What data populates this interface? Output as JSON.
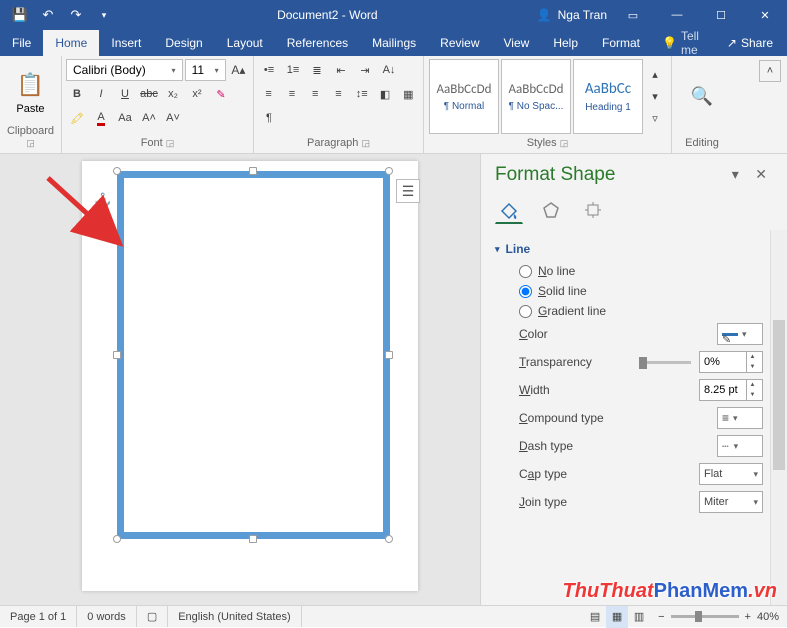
{
  "titlebar": {
    "title": "Document2 - Word",
    "user": "Nga Tran"
  },
  "tabs": {
    "file": "File",
    "home": "Home",
    "insert": "Insert",
    "design": "Design",
    "layout": "Layout",
    "references": "References",
    "mailings": "Mailings",
    "review": "Review",
    "view": "View",
    "help": "Help",
    "format": "Format",
    "tellme": "Tell me",
    "share": "Share"
  },
  "ribbon": {
    "clipboard": {
      "paste": "Paste",
      "label": "Clipboard"
    },
    "font": {
      "name": "Calibri (Body)",
      "size": "11",
      "label": "Font"
    },
    "paragraph": {
      "label": "Paragraph"
    },
    "styles": {
      "label": "Styles",
      "list": [
        {
          "preview": "AaBbCcDd",
          "name": "¶ Normal"
        },
        {
          "preview": "AaBbCcDd",
          "name": "¶ No Spac..."
        },
        {
          "preview": "AaBbCc",
          "name": "Heading 1"
        }
      ]
    },
    "editing": {
      "label": "Editing"
    }
  },
  "pane": {
    "title": "Format Shape",
    "section": "Line",
    "radios": {
      "none": "No line",
      "solid": "Solid line",
      "gradient": "Gradient line",
      "selected": "solid"
    },
    "props": {
      "color": {
        "label": "Color"
      },
      "transparency": {
        "label": "Transparency",
        "value": "0%"
      },
      "width": {
        "label": "Width",
        "value": "8.25 pt"
      },
      "compound": {
        "label": "Compound type"
      },
      "dash": {
        "label": "Dash type"
      },
      "cap": {
        "label": "Cap type",
        "value": "Flat"
      },
      "join": {
        "label": "Join type",
        "value": "Miter"
      }
    }
  },
  "status": {
    "page": "Page 1 of 1",
    "words": "0 words",
    "lang": "English (United States)",
    "zoom": "40%"
  },
  "watermark": {
    "a": "ThuThuat",
    "b": "PhanMem",
    "c": ".vn"
  }
}
